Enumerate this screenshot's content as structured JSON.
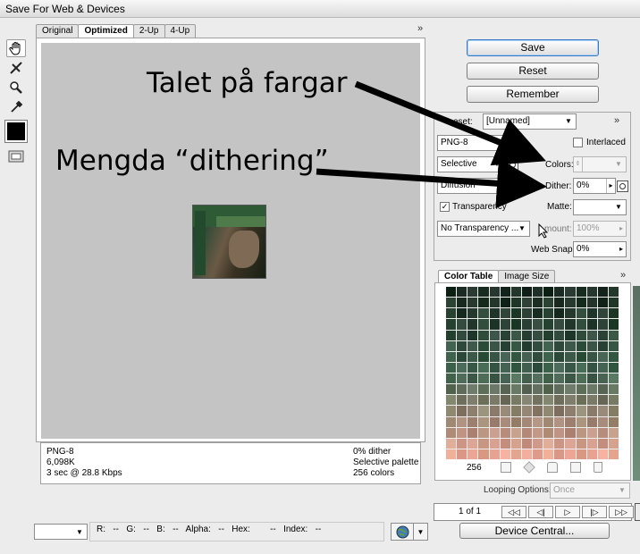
{
  "window": {
    "title": "Save For Web & Devices"
  },
  "tools": [
    {
      "name": "hand-tool-icon",
      "selected": true
    },
    {
      "name": "slice-select-tool-icon",
      "selected": false
    },
    {
      "name": "zoom-tool-icon",
      "selected": false
    },
    {
      "name": "eyedropper-tool-icon",
      "selected": false
    }
  ],
  "tabs": [
    "Original",
    "Optimized",
    "2-Up",
    "4-Up"
  ],
  "active_tab": "Optimized",
  "info": {
    "format": "PNG-8",
    "size": "6,098K",
    "time": "3 sec @ 28.8 Kbps",
    "dither": "0% dither",
    "palette": "Selective palette",
    "colors": "256 colors"
  },
  "buttons": {
    "save": "Save",
    "reset": "Reset",
    "remember": "Remember"
  },
  "preset": {
    "label": "Preset:",
    "visible_label": "eset:",
    "value": "[Unnamed]"
  },
  "settings": {
    "format": "PNG-8",
    "reduction": "Selective",
    "dither_algorithm": "Diffusion",
    "interlaced_label": "Interlaced",
    "colors_label": "Colors:",
    "dither_label": "Dither:",
    "dither_value": "0%",
    "transparency_label": "Transparency",
    "matte_label": "Matte:",
    "transparency_dither": "No Transparency ...",
    "amount_label": "mount:",
    "amount_value": "100%",
    "websnap_label": "Web Snap:",
    "websnap_value": "0%"
  },
  "color_table": {
    "tabs": [
      "Color Table",
      "Image Size"
    ],
    "count": "256"
  },
  "looping": {
    "label": "Looping Options:",
    "value": "Once"
  },
  "animation": {
    "frame": "1 of 1"
  },
  "device_central": "Device Central...",
  "readout": {
    "r": "R:",
    "r_val": "--",
    "g": "G:",
    "g_val": "--",
    "b": "B:",
    "b_val": "--",
    "alpha": "Alpha:",
    "alpha_val": "--",
    "hex": "Hex:",
    "hex_val": "--",
    "index": "Index:",
    "index_val": "--"
  },
  "annotations": {
    "colors": "Talet på fargar",
    "dither": "Mengda “dithering”"
  },
  "colors": {
    "palette_dark": "#1b2a22",
    "palette_green": "#3e5e4d",
    "palette_salmon": "#e8a292",
    "accent_blue": "#3a78c4"
  }
}
